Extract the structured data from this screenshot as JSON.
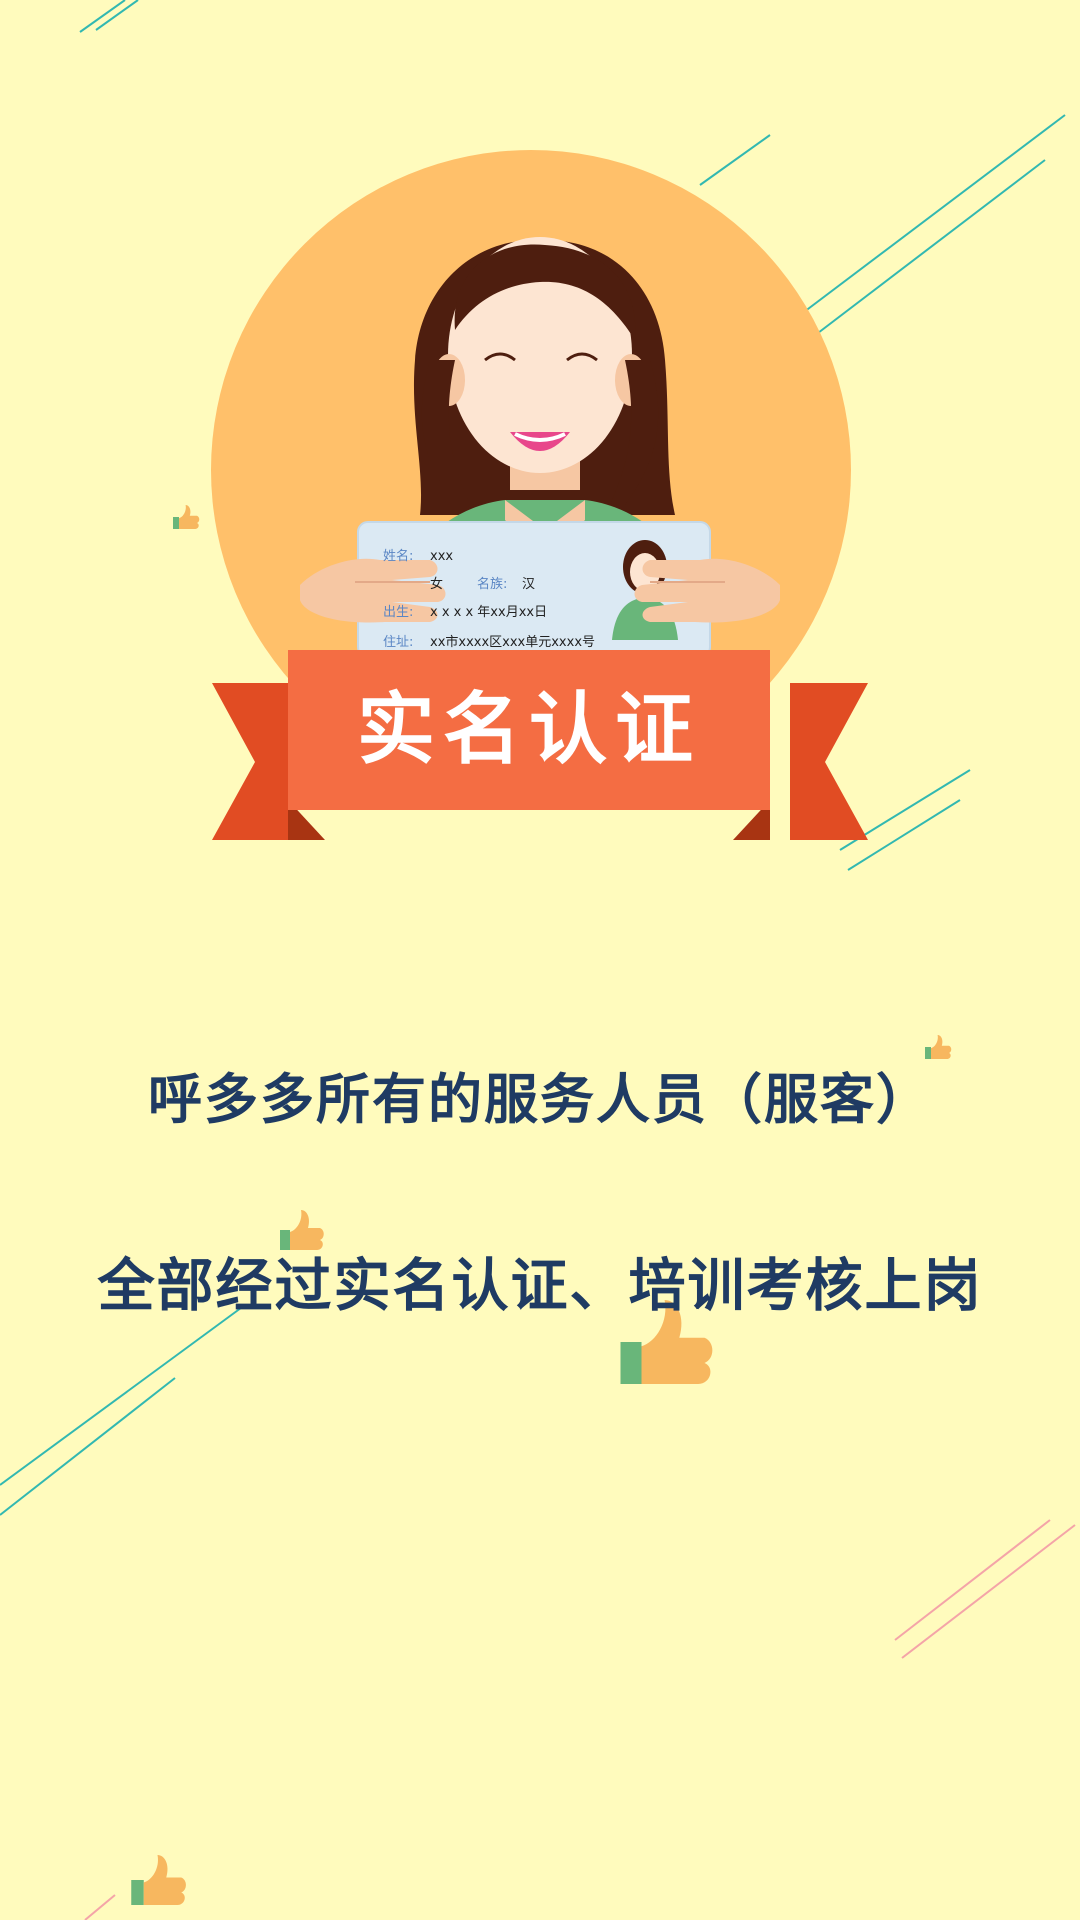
{
  "colors": {
    "background": "#fffbbd",
    "circle": "#ffc06a",
    "ribbon_front": "#f46d43",
    "ribbon_back": "#e14c23",
    "text_dark": "#1f3b63",
    "line_teal": "#32b8b1",
    "line_pink": "#f4a4a8"
  },
  "icons": {
    "deco_thumbs": [
      "thumbs-up-icon",
      "thumbs-up-icon",
      "thumbs-up-icon",
      "thumbs-up-icon",
      "thumbs-up-icon",
      "thumbs-up-icon"
    ]
  },
  "id_card": {
    "name_label": "姓名:",
    "name_value": "xxx",
    "gender_value": "女",
    "ethnicity_label": "名族:",
    "ethnicity_value": "汉",
    "birth_label": "出生:",
    "birth_value": "x x x x 年xx月xx日",
    "address_label": "住址:",
    "address_value": "xx市xxxx区xxx单元xxxx号"
  },
  "banner": {
    "title": "实名认证"
  },
  "caption": {
    "line1": "呼多多所有的服务人员（服客）",
    "line2": "全部经过实名认证、培训考核上岗"
  }
}
